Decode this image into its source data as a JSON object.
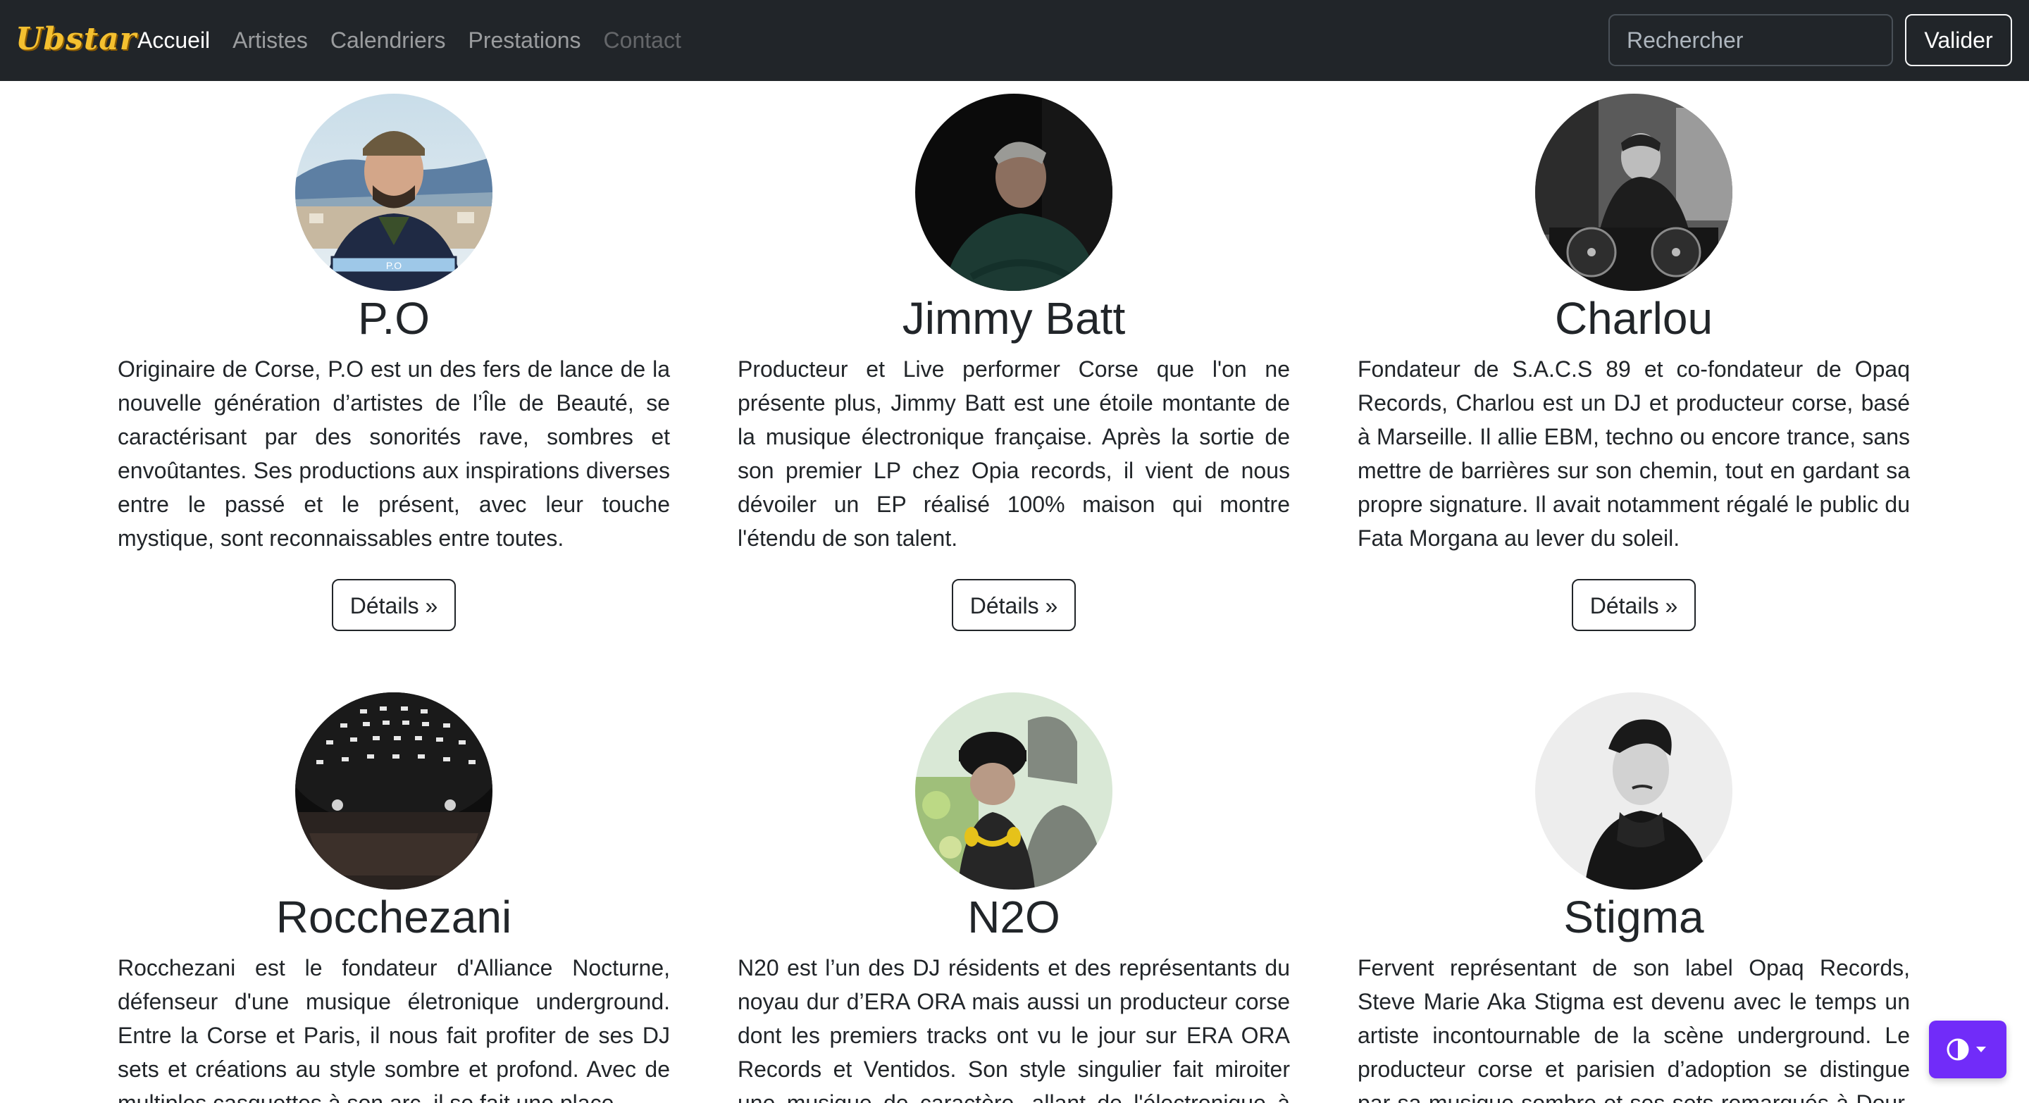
{
  "navbar": {
    "brand": "Ubstar",
    "links": [
      {
        "label": "Accueil"
      },
      {
        "label": "Artistes"
      },
      {
        "label": "Calendriers"
      },
      {
        "label": "Prestations"
      },
      {
        "label": "Contact"
      }
    ],
    "search_placeholder": "Rechercher",
    "submit_label": "Valider"
  },
  "artists": [
    {
      "name": "P.O",
      "avatar_label": "P.O",
      "bio": "Originaire de Corse, P.O est un des fers de lance de la nouvelle génération d’artistes de l’Île de Beauté, se caractérisant par des sonorités rave, sombres et envoûtantes. Ses productions aux inspirations diverses entre le passé et le présent, avec leur touche mystique, sont reconnaissables entre toutes.",
      "button": "Détails »"
    },
    {
      "name": "Jimmy Batt",
      "bio": "Producteur et Live performer Corse que l'on ne présente plus, Jimmy Batt est une étoile montante de la musique électronique française. Après la sortie de son premier LP chez Opia records, il vient de nous dévoiler un EP réalisé 100% maison qui montre l'étendu de son talent.",
      "button": "Détails »"
    },
    {
      "name": "Charlou",
      "bio": "Fondateur de S.A.C.S 89 et co-fondateur de Opaq Records, Charlou est un DJ et producteur corse, basé à Marseille. Il allie EBM, techno ou encore trance, sans mettre de barrières sur son chemin, tout en gardant sa propre signature. Il avait notamment régalé le public du Fata Morgana au lever du soleil.",
      "button": "Détails »"
    },
    {
      "name": "Rocchezani",
      "bio": "Rocchezani est le fondateur d'Alliance Nocturne, défenseur d'une musique életronique underground. Entre la Corse et Paris, il nous fait profiter de ses DJ sets et créations au style sombre et profond. Avec de multiples casquettes à son arc, il se fait une place."
    },
    {
      "name": "N2O",
      "bio": "N20 est l’un des DJ résidents et des représentants du noyau dur d’ERA ORA mais aussi un producteur corse dont les premiers tracks ont vu le jour sur ERA ORA Records et Ventidos. Son style singulier fait miroiter une musique de caractère, allant de l'électronique à l'ambiant."
    },
    {
      "name": "Stigma",
      "bio": "Fervent représentant de son label Opaq Records, Steve Marie Aka Stigma est devenu avec le temps un artiste incontournable de la scène underground. Le producteur corse et parisien d’adoption se distingue par sa musique sombre et ses sets remarqués à Dour, South Park."
    }
  ],
  "colors": {
    "navbar_bg": "#212529",
    "brand": "#f4c030",
    "theme_toggle": "#712cf9"
  }
}
